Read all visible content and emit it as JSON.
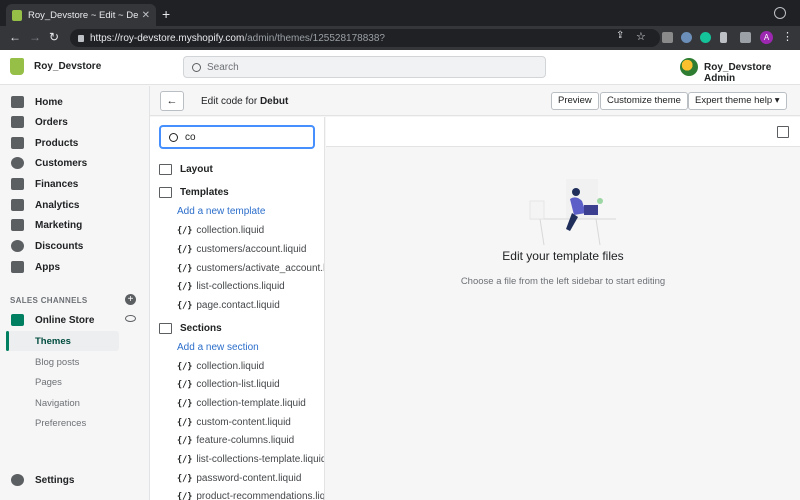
{
  "browser": {
    "tab_title": "Roy_Devstore ~ Edit ~ Debut ~",
    "url_base": "https://roy-devstore.myshopify.com",
    "url_path": "/admin/themes/125528178838?",
    "profile_initial": "A"
  },
  "topbar": {
    "store_name": "Roy_Devstore",
    "search_placeholder": "Search",
    "admin_name": "Roy_Devstore Admin"
  },
  "nav": {
    "items": [
      "Home",
      "Orders",
      "Products",
      "Customers",
      "Finances",
      "Analytics",
      "Marketing",
      "Discounts",
      "Apps"
    ],
    "channels_label": "SALES CHANNELS",
    "online_store": "Online Store",
    "sub_items": [
      "Themes",
      "Blog posts",
      "Pages",
      "Navigation",
      "Preferences"
    ],
    "settings": "Settings"
  },
  "header": {
    "title_prefix": "Edit code for",
    "theme_name": "Debut",
    "preview": "Preview",
    "customize": "Customize theme",
    "expert_help": "Expert theme help"
  },
  "tree": {
    "search_value": "co",
    "folders": {
      "layout": "Layout",
      "templates": "Templates",
      "sections": "Sections"
    },
    "add_template": "Add a new template",
    "add_section": "Add a new section",
    "template_files": [
      "collection.liquid",
      "customers/account.liquid",
      "customers/activate_account.liquid",
      "list-collections.liquid",
      "page.contact.liquid"
    ],
    "section_files": [
      "collection.liquid",
      "collection-list.liquid",
      "collection-template.liquid",
      "custom-content.liquid",
      "feature-columns.liquid",
      "list-collections-template.liquid",
      "password-content.liquid",
      "product-recommendations.liquid"
    ],
    "file_prefix": "{/}"
  },
  "editor": {
    "empty_title": "Edit your template files",
    "empty_sub": "Choose a file from the left sidebar to start editing"
  }
}
